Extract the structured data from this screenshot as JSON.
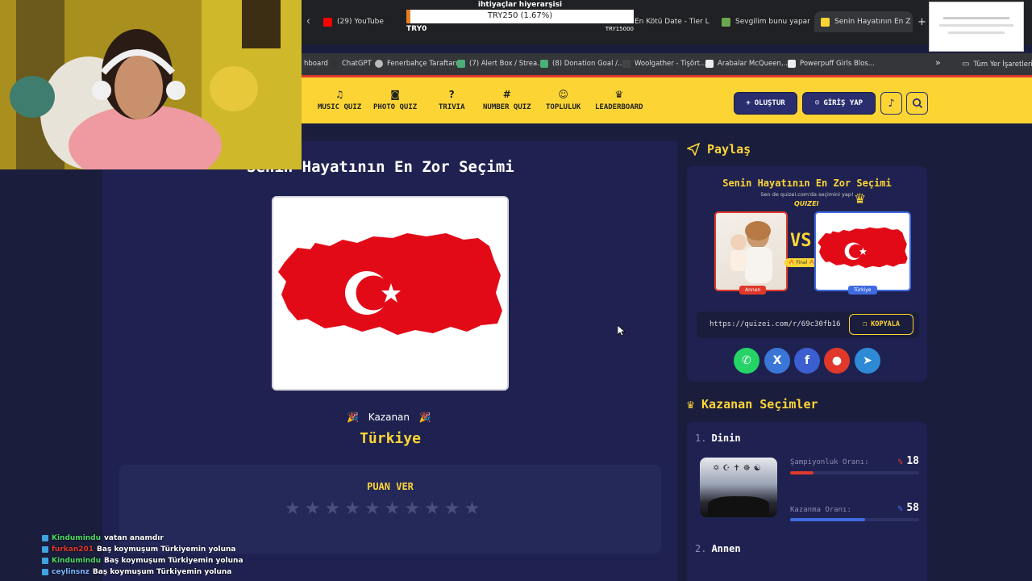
{
  "browser": {
    "tabs": [
      {
        "label": "(29) YouTube",
        "color": "#ff0000"
      },
      {
        "label": "En Kötü Date - Tier L",
        "color": "#f0c040"
      },
      {
        "label": "Sevgilim bunu yapar",
        "color": "#6aa84f"
      },
      {
        "label": "Senin Hayatının En Z",
        "color": "#fcd535"
      }
    ],
    "new_tab": "+",
    "bookmarks": [
      {
        "label": "hboard"
      },
      {
        "label": "ChatGPT"
      },
      {
        "label": "Fenerbahçe Taraftarı..."
      },
      {
        "label": "(7) Alert Box / Strea..."
      },
      {
        "label": "(8) Donation Goal /..."
      },
      {
        "label": "Woolgather - Tişört..."
      },
      {
        "label": "Arabalar McQueen,..."
      },
      {
        "label": "Powerpuff Girls Blos..."
      }
    ],
    "bookmarks_more": "»",
    "all_bookmarks": "Tüm Yer İşaretleri"
  },
  "donation_goal": {
    "title": "ihtiyaçlar hiyerarşisi",
    "value": "TRY250 (1.67%)",
    "min": "TRY0",
    "max": "TRY15000",
    "progress": 0.0167
  },
  "nav": {
    "items": [
      {
        "label": "MUSIC QUIZ",
        "icon": "music-icon"
      },
      {
        "label": "PHOTO QUIZ",
        "icon": "camera-icon"
      },
      {
        "label": "TRIVIA",
        "icon": "question-icon"
      },
      {
        "label": "NUMBER QUIZ",
        "icon": "hash-icon"
      },
      {
        "label": "TOPLULUK",
        "icon": "users-icon"
      },
      {
        "label": "LEADERBOARD",
        "icon": "trophy-icon"
      }
    ],
    "create_label": "OLUŞTUR",
    "login_label": "GİRİŞ YAP"
  },
  "main": {
    "title": "Senin Hayatının En Zor Seçimi",
    "kazanan_label": "Kazanan",
    "winner_name": "Türkiye",
    "rating_title": "PUAN VER",
    "stars": 10
  },
  "share": {
    "heading": "Paylaş",
    "card_title": "Senin Hayatının En Zor Seçimi",
    "card_subtitle": "Sen de quizei.com'da seçimini yap!",
    "brand": "QUIZEI",
    "vs": "VS",
    "final_label": "Final",
    "left_tag": "Annen",
    "right_tag": "Türkiye",
    "url": "https://quizei.com/r/69c30fb16",
    "copy_label": "KOPYALA",
    "socials": [
      {
        "name": "whatsapp",
        "color": "#25d366",
        "glyph": "✆"
      },
      {
        "name": "x",
        "color": "#3a76d6",
        "glyph": "X"
      },
      {
        "name": "facebook",
        "color": "#3b5ed0",
        "glyph": "f"
      },
      {
        "name": "reddit",
        "color": "#e0382b",
        "glyph": "●"
      },
      {
        "name": "telegram",
        "color": "#2f8ad6",
        "glyph": "➤"
      }
    ]
  },
  "winners": {
    "heading": "Kazanan Seçimler",
    "items": [
      {
        "rank": "1.",
        "name": "Dinin",
        "champ_label": "Şampiyonluk Oranı:",
        "champ_pct": "%",
        "champ_value": "18",
        "win_label": "Kazanma Oranı:",
        "win_pct": "%",
        "win_value": "58"
      },
      {
        "rank": "2.",
        "name": "Annen"
      }
    ]
  },
  "chat": [
    {
      "user": "Kindumindu",
      "color": "#4cd964",
      "msg": "vatan anamdır"
    },
    {
      "user": "furkan201",
      "color": "#e0382b",
      "msg": "Baş koymuşum Türkiyemin yoluna"
    },
    {
      "user": "Kindumindu",
      "color": "#4cd964",
      "msg": "Baş koymuşum Türkiyemin yoluna"
    },
    {
      "user": "ceylinsnz",
      "color": "#7ab8ff",
      "msg": "Baş koymuşum Türkiyemin yoluna"
    }
  ]
}
